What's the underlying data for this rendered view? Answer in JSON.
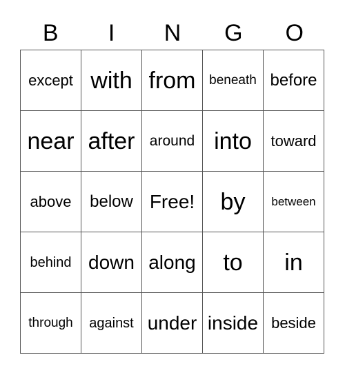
{
  "header": [
    "B",
    "I",
    "N",
    "G",
    "O"
  ],
  "cells": [
    [
      {
        "t": "except",
        "s": 22
      },
      {
        "t": "with",
        "s": 34
      },
      {
        "t": "from",
        "s": 34
      },
      {
        "t": "beneath",
        "s": 19
      },
      {
        "t": "before",
        "s": 24
      }
    ],
    [
      {
        "t": "near",
        "s": 34
      },
      {
        "t": "after",
        "s": 34
      },
      {
        "t": "around",
        "s": 21
      },
      {
        "t": "into",
        "s": 34
      },
      {
        "t": "toward",
        "s": 22
      }
    ],
    [
      {
        "t": "above",
        "s": 22
      },
      {
        "t": "below",
        "s": 24
      },
      {
        "t": "Free!",
        "s": 28
      },
      {
        "t": "by",
        "s": 34
      },
      {
        "t": "between",
        "s": 17
      }
    ],
    [
      {
        "t": "behind",
        "s": 20
      },
      {
        "t": "down",
        "s": 28
      },
      {
        "t": "along",
        "s": 28
      },
      {
        "t": "to",
        "s": 34
      },
      {
        "t": "in",
        "s": 34
      }
    ],
    [
      {
        "t": "through",
        "s": 19
      },
      {
        "t": "against",
        "s": 20
      },
      {
        "t": "under",
        "s": 28
      },
      {
        "t": "inside",
        "s": 28
      },
      {
        "t": "beside",
        "s": 22
      }
    ]
  ]
}
